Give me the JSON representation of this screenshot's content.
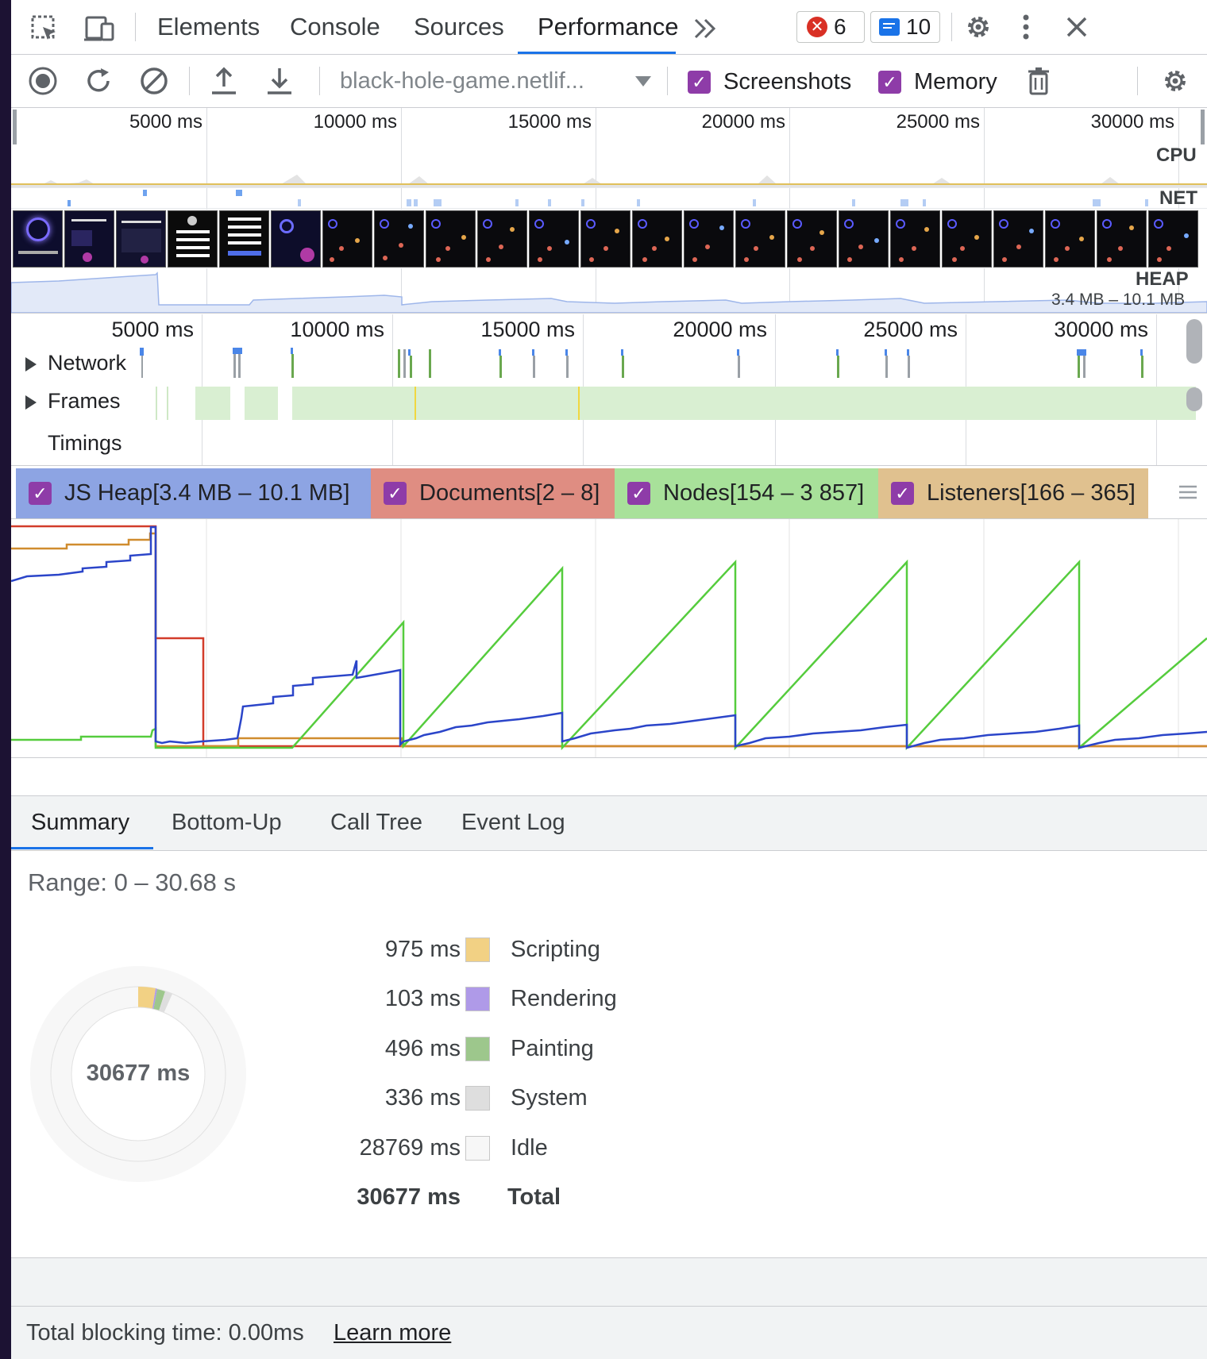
{
  "toolbar": {
    "tabs": [
      "Elements",
      "Console",
      "Sources",
      "Performance"
    ],
    "active_tab": "Performance",
    "error_count": "6",
    "message_count": "10",
    "url_select": "black-hole-game.netlif...",
    "screenshots_label": "Screenshots",
    "memory_label": "Memory",
    "screenshots_checked": true,
    "memory_checked": true
  },
  "overview": {
    "ticks": [
      "5000 ms",
      "10000 ms",
      "15000 ms",
      "20000 ms",
      "25000 ms",
      "30000 ms"
    ],
    "cpu_label": "CPU",
    "net_label": "NET",
    "heap_label": "HEAP",
    "heap_range": "3.4 MB – 10.1 MB"
  },
  "timeline": {
    "ticks": [
      "5000 ms",
      "10000 ms",
      "15000 ms",
      "20000 ms",
      "25000 ms",
      "30000 ms"
    ],
    "tracks": [
      "Network",
      "Frames",
      "Timings"
    ]
  },
  "counters": {
    "items": [
      {
        "label": "JS Heap[3.4 MB – 10.1 MB]",
        "color": "#8da4e3",
        "checked": true
      },
      {
        "label": "Documents[2 – 8]",
        "color": "#df8d82",
        "checked": true
      },
      {
        "label": "Nodes[154 – 3 857]",
        "color": "#a8e19a",
        "checked": true
      },
      {
        "label": "Listeners[166 – 365]",
        "color": "#e0c18f",
        "checked": true
      }
    ]
  },
  "chart_data": {
    "type": "line",
    "x_unit": "ms",
    "x_range": [
      0,
      30677
    ],
    "series": [
      {
        "name": "JS Heap",
        "color": "#2b45c9",
        "y_range": [
          "3.4 MB",
          "10.1 MB"
        ]
      },
      {
        "name": "Documents",
        "color": "#d23c2a",
        "y_range": [
          2,
          8
        ]
      },
      {
        "name": "Nodes",
        "color": "#55cc3d",
        "y_range": [
          154,
          3857
        ]
      },
      {
        "name": "Listeners",
        "color": "#d08c2e",
        "y_range": [
          166,
          365
        ]
      }
    ]
  },
  "bottom": {
    "tabs": [
      "Summary",
      "Bottom-Up",
      "Call Tree",
      "Event Log"
    ],
    "active_tab": "Summary",
    "range": "Range: 0 – 30.68 s",
    "donut_total": "30677 ms",
    "rows": [
      {
        "value": "975 ms",
        "label": "Scripting",
        "color": "#f2d184"
      },
      {
        "value": "103 ms",
        "label": "Rendering",
        "color": "#af9ae8"
      },
      {
        "value": "496 ms",
        "label": "Painting",
        "color": "#9dc78c"
      },
      {
        "value": "336 ms",
        "label": "System",
        "color": "#dedede"
      },
      {
        "value": "28769 ms",
        "label": "Idle",
        "color": "#f7f7f7"
      }
    ],
    "total_value": "30677 ms",
    "total_label": "Total",
    "footer_text": "Total blocking time: 0.00ms",
    "learn_more": "Learn more"
  }
}
